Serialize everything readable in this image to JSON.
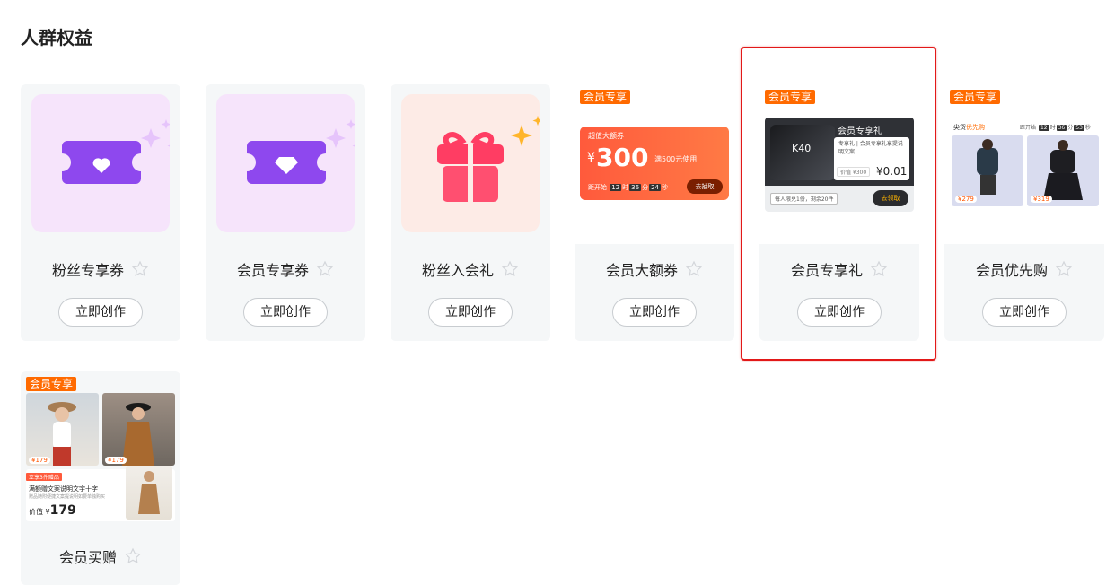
{
  "section": {
    "title": "人群权益"
  },
  "cards": [
    {
      "name": "粉丝专享券",
      "button": "立即创作"
    },
    {
      "name": "会员专享券",
      "button": "立即创作"
    },
    {
      "name": "粉丝入会礼",
      "button": "立即创作"
    },
    {
      "name": "会员大额券",
      "button": "立即创作",
      "badge": "会员专享",
      "preview": {
        "title": "超值大额券",
        "currency": "¥",
        "amount": "300",
        "condition": "满500元使用",
        "countdown_prefix": "距开始",
        "countdown": [
          "12",
          "36",
          "24"
        ],
        "countdown_units": [
          "时",
          "分",
          "秒"
        ],
        "cta": "去抽取"
      }
    },
    {
      "name": "会员专享礼",
      "button": "立即创作",
      "badge": "会员专享",
      "selected": true,
      "preview": {
        "title": "会员专享礼",
        "model": "K40",
        "desc": "专享礼 | 会员专享礼享提说明文案",
        "value_label": "价值 ¥300",
        "price": "¥0.01",
        "limit": "每人限兑1份，剩余20件",
        "cta": "去领取"
      }
    },
    {
      "name": "会员优先购",
      "button": "立即创作",
      "badge": "会员专享",
      "preview": {
        "title_prefix": "尖货",
        "title_highlight": "优先购",
        "countdown_prefix": "距开始",
        "countdown": [
          "12",
          "36",
          "53"
        ],
        "countdown_units": [
          "时",
          "分",
          "秒"
        ],
        "prices": [
          "¥279",
          "¥319"
        ]
      }
    },
    {
      "name": "会员买赠",
      "button": "立即创作",
      "badge": "会员专享",
      "preview": {
        "prices": [
          "¥179",
          "¥179"
        ],
        "tag": "立享3件赠品",
        "line1": "满额赠文案说明文字十字",
        "line2": "赠品随附便捷文案提说明如要单独购买",
        "value_label": "价值",
        "value_currency": "¥",
        "value": "179"
      }
    }
  ],
  "colors": {
    "accent": "#ff6a00",
    "selected_border": "#e21818",
    "card_bg": "#f5f7f8"
  },
  "icons": [
    "heart-ticket-icon",
    "diamond-ticket-icon",
    "gift-box-icon",
    "sparkle-icon",
    "star-outline-icon"
  ]
}
